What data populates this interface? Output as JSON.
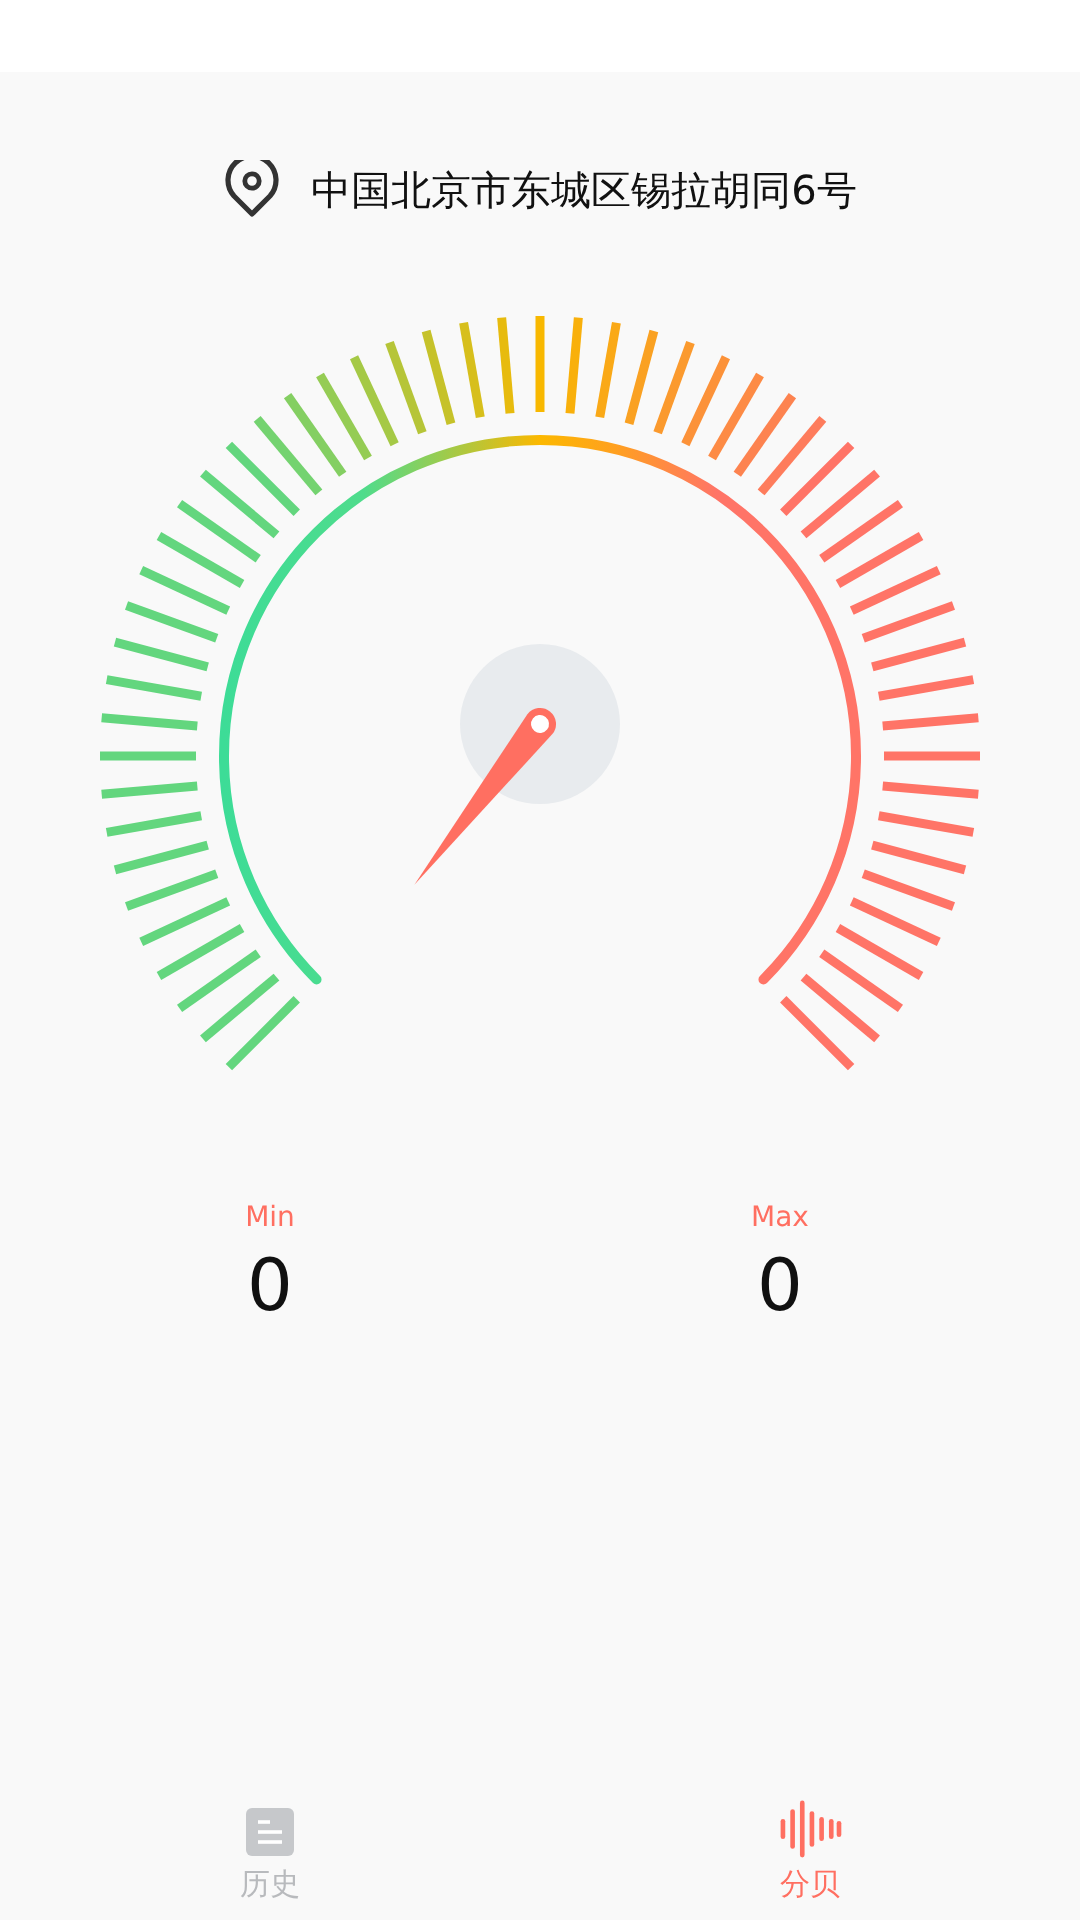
{
  "location": {
    "address": "中国北京市东城区锡拉胡同6号"
  },
  "stats": [
    {
      "label": "Min",
      "value": "0"
    },
    {
      "label": "Max",
      "value": "0"
    }
  ],
  "tabs": [
    {
      "label": "历史",
      "kind": "history",
      "selected": false
    },
    {
      "label": "分贝",
      "kind": "decibel",
      "selected": true
    }
  ]
}
